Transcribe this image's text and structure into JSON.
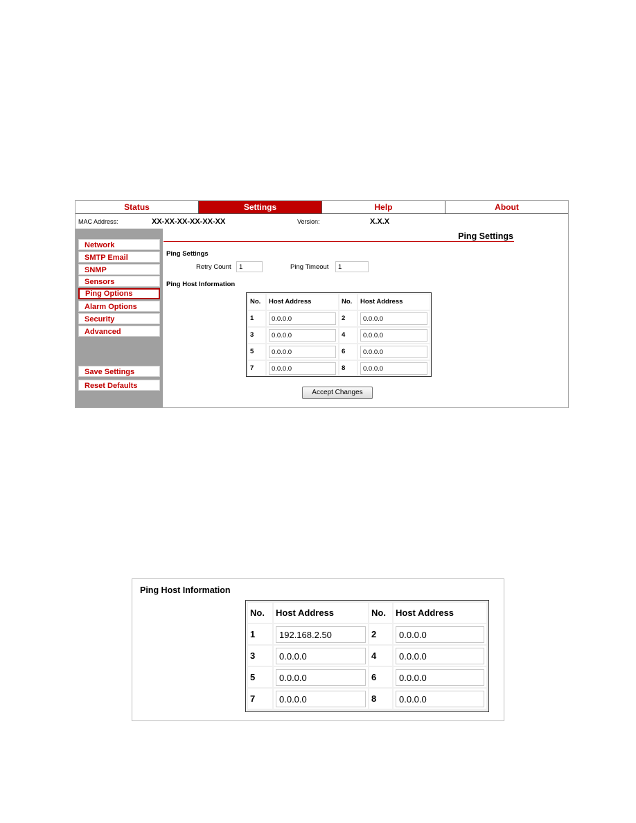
{
  "tabs": [
    {
      "label": "Status",
      "active": false
    },
    {
      "label": "Settings",
      "active": true
    },
    {
      "label": "Help",
      "active": false
    },
    {
      "label": "About",
      "active": false
    }
  ],
  "info": {
    "mac_label": "MAC Address:",
    "mac_value": "XX-XX-XX-XX-XX-XX",
    "version_label": "Version:",
    "version_value": "X.X.X"
  },
  "sidebar": {
    "items": [
      {
        "label": "Network"
      },
      {
        "label": "SMTP Email"
      },
      {
        "label": "SNMP"
      },
      {
        "label": "Sensors"
      },
      {
        "label": "Ping Options",
        "selected": true
      },
      {
        "label": "Alarm Options"
      },
      {
        "label": "Security"
      },
      {
        "label": "Advanced"
      }
    ],
    "save_label": "Save Settings",
    "reset_label": "Reset Defaults"
  },
  "page": {
    "title": "Ping Settings",
    "ping_section": "Ping Settings",
    "retry_label": "Retry Count",
    "retry_value": "1",
    "timeout_label": "Ping Timeout",
    "timeout_value": "1",
    "host_section": "Ping Host Information",
    "col_no": "No.",
    "col_host": "Host Address",
    "hosts": [
      {
        "no": "1",
        "address": "0.0.0.0"
      },
      {
        "no": "2",
        "address": "0.0.0.0"
      },
      {
        "no": "3",
        "address": "0.0.0.0"
      },
      {
        "no": "4",
        "address": "0.0.0.0"
      },
      {
        "no": "5",
        "address": "0.0.0.0"
      },
      {
        "no": "6",
        "address": "0.0.0.0"
      },
      {
        "no": "7",
        "address": "0.0.0.0"
      },
      {
        "no": "8",
        "address": "0.0.0.0"
      }
    ],
    "accept_label": "Accept Changes"
  },
  "zoomed": {
    "title": "Ping Host Information",
    "col_no": "No.",
    "col_host": "Host Address",
    "hosts": [
      {
        "no": "1",
        "address": "192.168.2.50"
      },
      {
        "no": "2",
        "address": "0.0.0.0"
      },
      {
        "no": "3",
        "address": "0.0.0.0"
      },
      {
        "no": "4",
        "address": "0.0.0.0"
      },
      {
        "no": "5",
        "address": "0.0.0.0"
      },
      {
        "no": "6",
        "address": "0.0.0.0"
      },
      {
        "no": "7",
        "address": "0.0.0.0"
      },
      {
        "no": "8",
        "address": "0.0.0.0"
      }
    ]
  }
}
